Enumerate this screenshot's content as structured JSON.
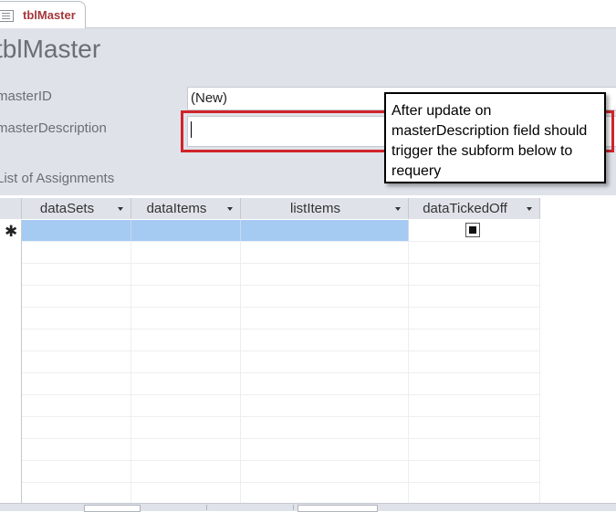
{
  "tab": {
    "label": "tblMaster",
    "icon": "form-icon"
  },
  "form": {
    "title": "tblMaster",
    "fields": [
      {
        "label": "masterID",
        "value": "(New)"
      },
      {
        "label": "masterDescription",
        "value": ""
      }
    ],
    "subform_label": "List of Assignments"
  },
  "callout": {
    "text": "After update on masterDescription field should trigger the subform below to requery"
  },
  "datasheet": {
    "columns": [
      "dataSets",
      "dataItems",
      "listItems",
      "dataTickedOff"
    ],
    "new_row_marker": "✱",
    "new_row_checkbox_state": "null"
  },
  "colors": {
    "accent": "#a4373a",
    "selection": "#a6cbf3",
    "highlight_border": "#d0242a"
  }
}
